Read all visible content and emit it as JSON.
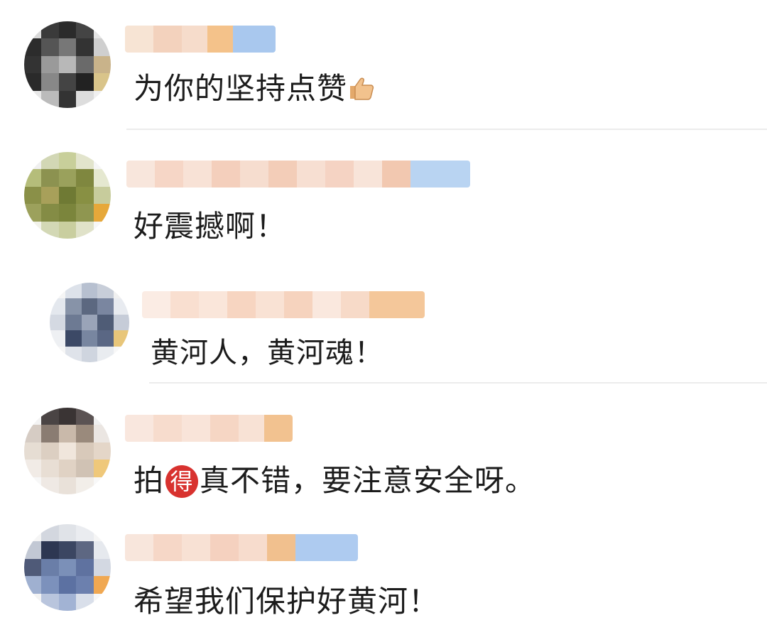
{
  "comments": [
    {
      "text": "为你的坚持点赞",
      "has_thumb_icon": true
    },
    {
      "text": "好震撼啊！"
    },
    {
      "text": "黄河人，黄河魂！",
      "is_reply": true
    },
    {
      "text_before": "拍",
      "badge": "得",
      "text_after": "真不错，要注意安全呀。"
    },
    {
      "text": "希望我们保护好黄河！"
    }
  ]
}
